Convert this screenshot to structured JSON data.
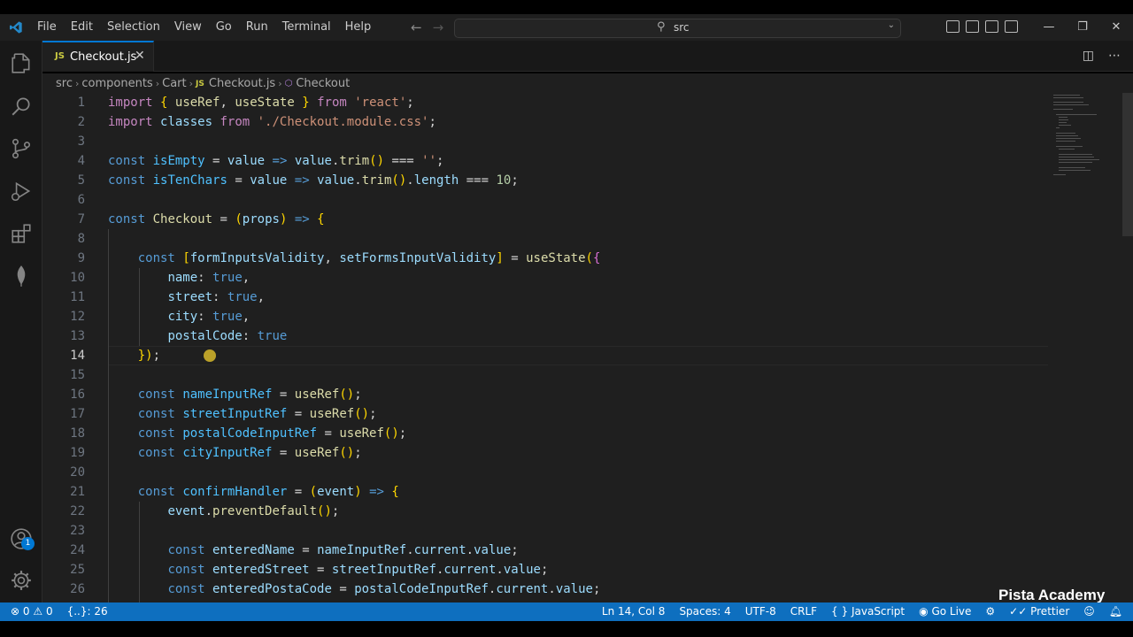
{
  "menu": [
    "File",
    "Edit",
    "Selection",
    "View",
    "Go",
    "Run",
    "Terminal",
    "Help"
  ],
  "command_center": {
    "text": "src"
  },
  "tab": {
    "badge": "JS",
    "name": "Checkout.js"
  },
  "breadcrumb": {
    "items": [
      "src",
      "components",
      "Cart"
    ],
    "file_badge": "JS",
    "file": "Checkout.js",
    "symbol": "Checkout"
  },
  "line_numbers": [
    "1",
    "2",
    "3",
    "4",
    "5",
    "6",
    "7",
    "8",
    "9",
    "10",
    "11",
    "12",
    "13",
    "14",
    "15",
    "16",
    "17",
    "18",
    "19",
    "20",
    "21",
    "22",
    "23",
    "24",
    "25",
    "26"
  ],
  "active_line": "14",
  "code_lines": [
    "import { useRef, useState } from 'react';",
    "import classes from './Checkout.module.css';",
    "",
    "const isEmpty = value => value.trim() === '';",
    "const isTenChars = value => value.trim().length === 10;",
    "",
    "const Checkout = (props) => {",
    "",
    "    const [formInputsValidity, setFormsInputValidity] = useState({",
    "        name: true,",
    "        street: true,",
    "        city: true,",
    "        postalCode: true",
    "    });",
    "",
    "    const nameInputRef = useRef();",
    "    const streetInputRef = useRef();",
    "    const postalCodeInputRef = useRef();",
    "    const cityInputRef = useRef();",
    "",
    "    const confirmHandler = (event) => {",
    "        event.preventDefault();",
    "",
    "        const enteredName = nameInputRef.current.value;",
    "        const enteredStreet = streetInputRef.current.value;",
    "        const enteredPostaCode = postalCodeInputRef.current.value;"
  ],
  "status": {
    "errors": "0",
    "warnings": "0",
    "braces": "{..}: 26",
    "position": "Ln 14, Col 8",
    "spaces": "Spaces: 4",
    "encoding": "UTF-8",
    "eol": "CRLF",
    "language_icon": "{ }",
    "language": "JavaScript",
    "go_live": "Go Live",
    "prettier": "Prettier"
  },
  "accounts_badge": "1",
  "watermark": "Pista Academy",
  "colors": {
    "accent": "#0078d4",
    "status_bar": "#0e6fbf",
    "editor_bg": "#1f1f1f",
    "keyword": "#569cd6",
    "string": "#ce9178",
    "function": "#dcdcaa",
    "variable": "#9cdcfe"
  }
}
